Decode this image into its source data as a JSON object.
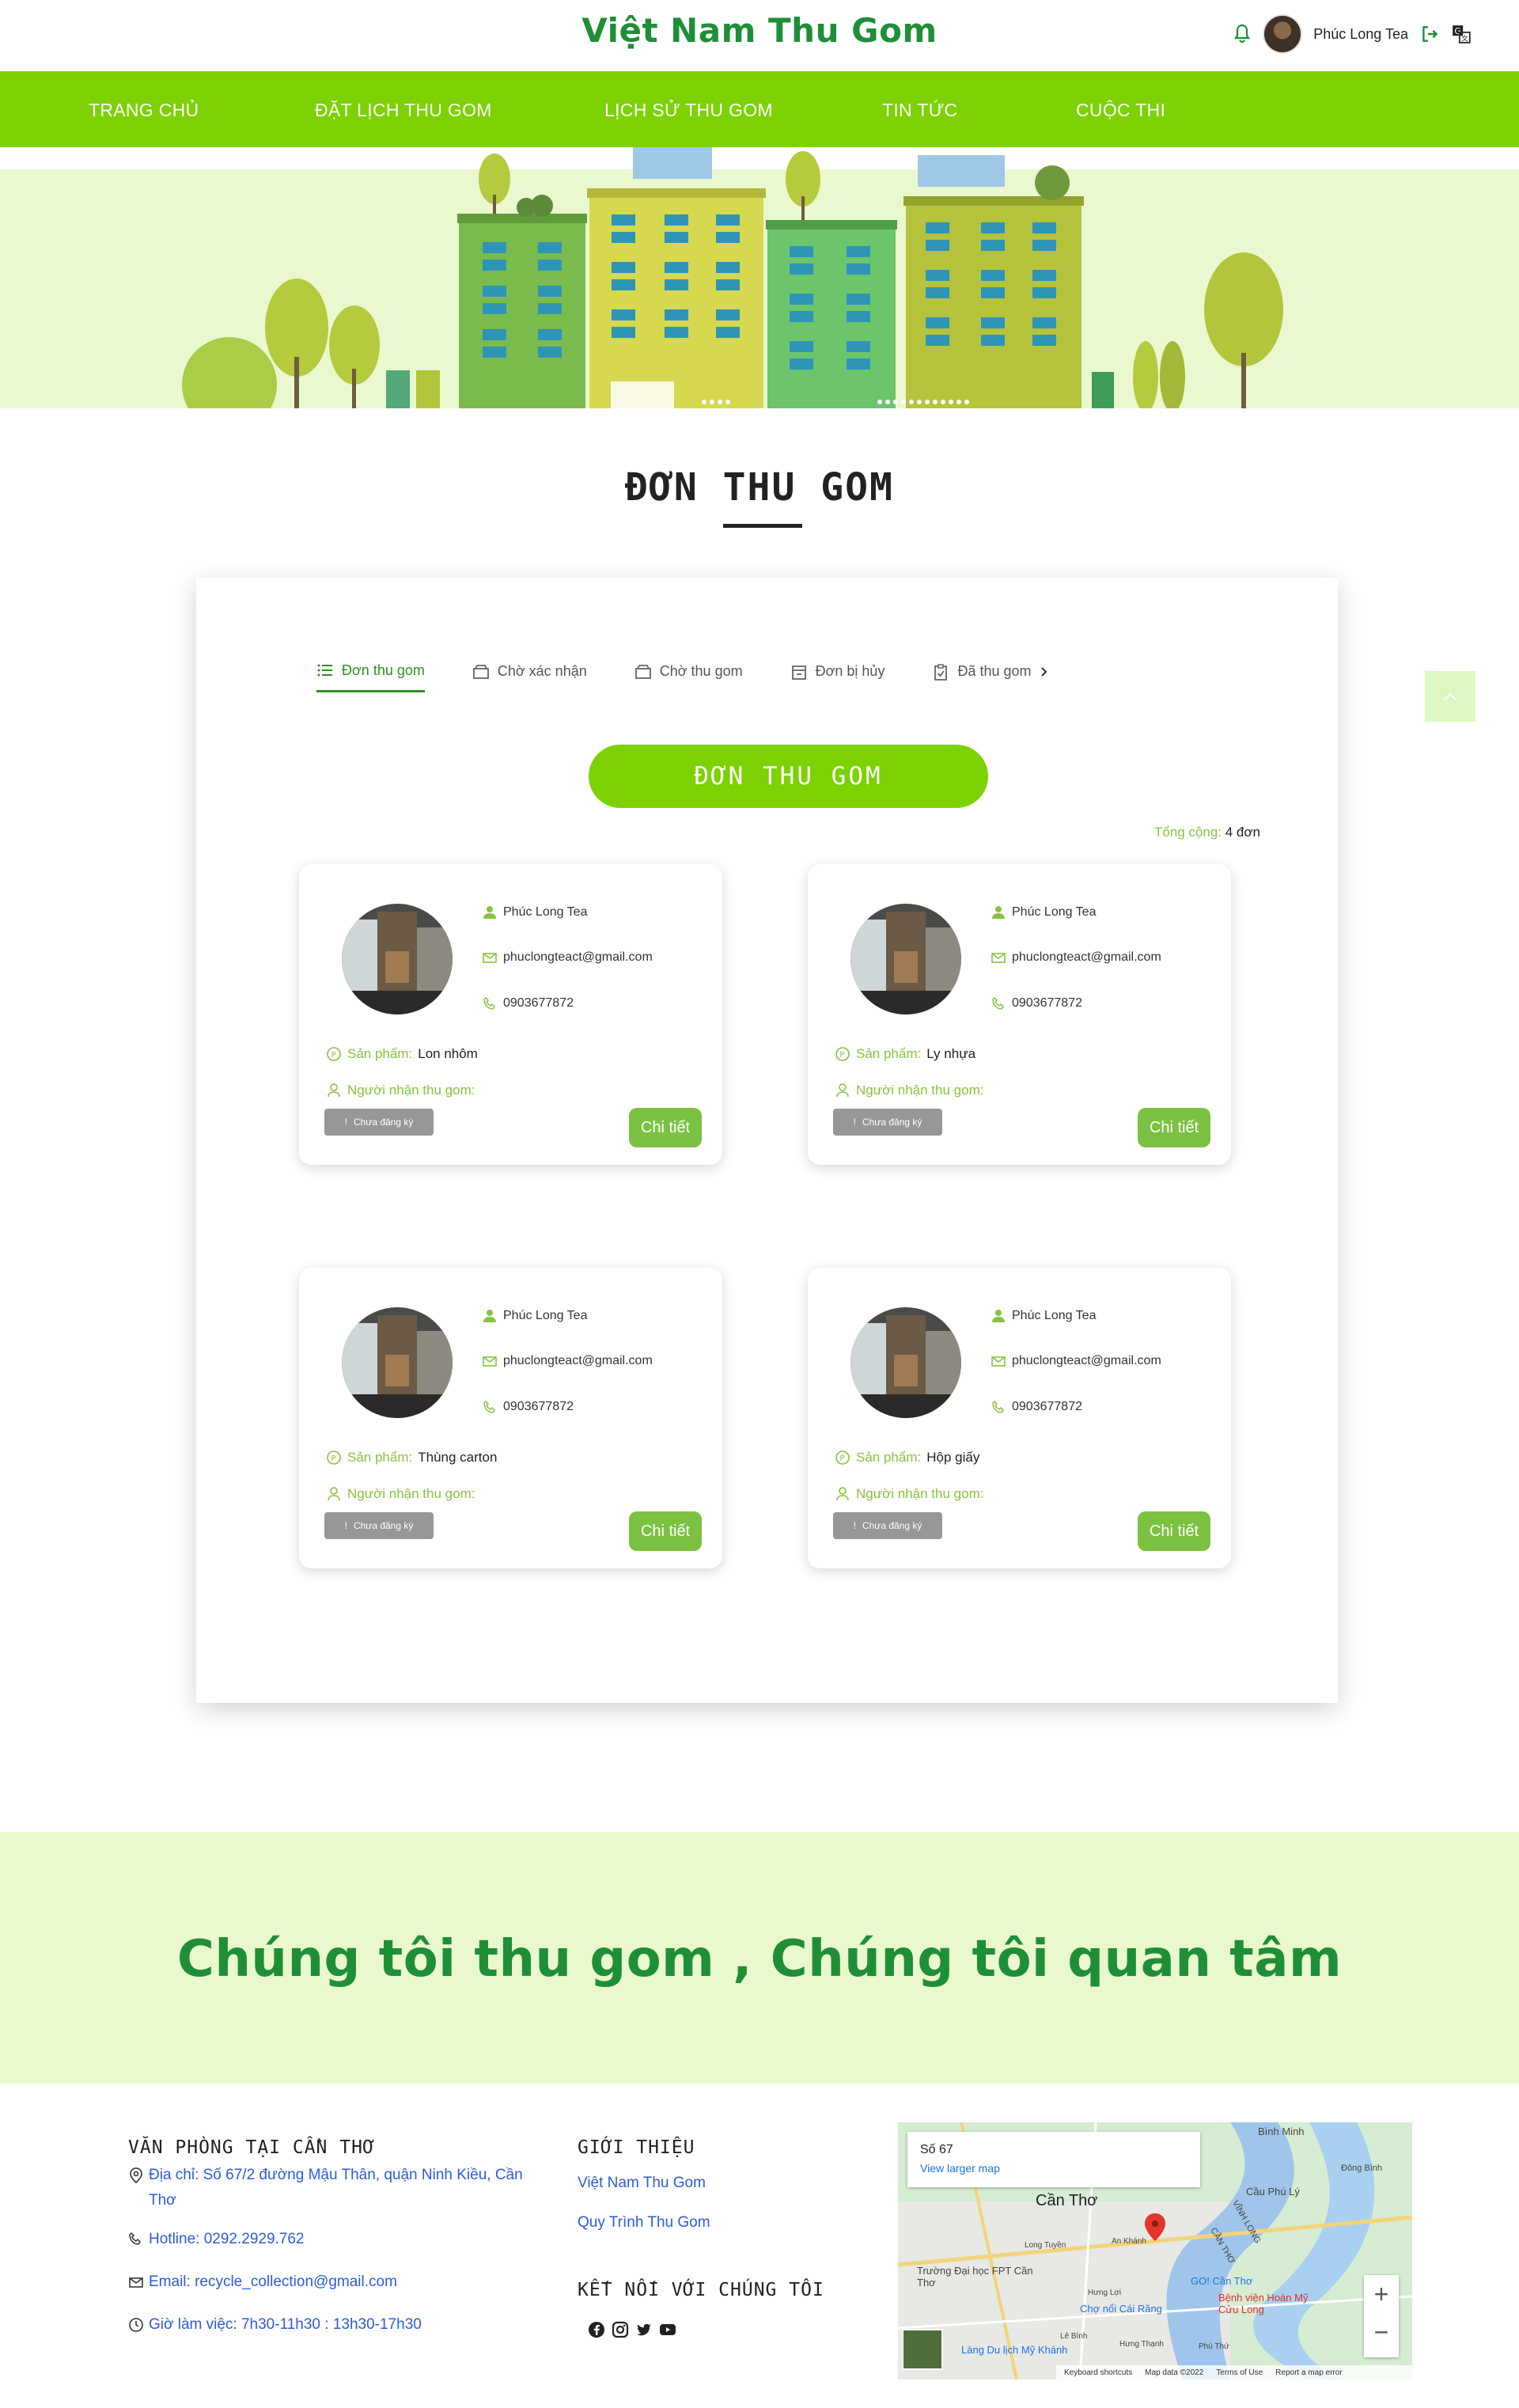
{
  "header": {
    "brand": "Việt Nam Thu Gom",
    "user_name": "Phúc Long Tea"
  },
  "nav": {
    "items": [
      "TRANG CHỦ",
      "ĐẶT LỊCH THU GOM",
      "LỊCH SỬ THU GOM",
      "TIN TỨC",
      "CUỘC THI"
    ]
  },
  "section": {
    "title": "ĐƠN THU GOM"
  },
  "tabs": [
    {
      "label": "Đơn thu gom",
      "icon": "list-icon",
      "active": true
    },
    {
      "label": "Chờ xác nhận",
      "icon": "box-icon",
      "active": false
    },
    {
      "label": "Chờ thu gom",
      "icon": "box-icon",
      "active": false
    },
    {
      "label": "Đơn bị hủy",
      "icon": "calendar-icon",
      "active": false
    },
    {
      "label": "Đã thu gom",
      "icon": "clipboard-check-icon",
      "active": false
    }
  ],
  "order_button": "ĐƠN THU GOM",
  "total": {
    "label": "Tổng cộng:",
    "value": "4 đơn"
  },
  "orders": [
    {
      "name": "Phúc Long Tea",
      "email": "phuclongteact@gmail.com",
      "phone": "0903677872",
      "product_label": "Sản phẩm:",
      "product": "Lon nhôm",
      "receiver_label": "Người nhận thu gom:",
      "status": "Chưa đăng ký",
      "button": "Chi tiết"
    },
    {
      "name": "Phúc Long Tea",
      "email": "phuclongteact@gmail.com",
      "phone": "0903677872",
      "product_label": "Sản phẩm:",
      "product": "Ly nhựa",
      "receiver_label": "Người nhận thu gom:",
      "status": "Chưa đăng ký",
      "button": "Chi tiết"
    },
    {
      "name": "Phúc Long Tea",
      "email": "phuclongteact@gmail.com",
      "phone": "0903677872",
      "product_label": "Sản phẩm:",
      "product": "Thùng carton",
      "receiver_label": "Người nhận thu gom:",
      "status": "Chưa đăng ký",
      "button": "Chi tiết"
    },
    {
      "name": "Phúc Long Tea",
      "email": "phuclongteact@gmail.com",
      "phone": "0903677872",
      "product_label": "Sản phẩm:",
      "product": "Hộp giấy",
      "receiver_label": "Người nhận thu gom:",
      "status": "Chưa đăng ký",
      "button": "Chi tiết"
    }
  ],
  "slogan": "Chúng tôi thu gom , Chúng tôi quan tâm",
  "footer": {
    "office_heading": "VĂN PHÒNG TẠI CẦN THƠ",
    "address": "Địa chỉ: Số 67/2 đường Mậu Thân, quận Ninh Kiều, Cần Thơ",
    "hotline": "Hotline: 0292.2929.762",
    "email": "Email: recycle_collection@gmail.com",
    "hours": "Giờ làm việc: 7h30-11h30 : 13h30-17h30",
    "about_heading": "GIỚI THIỆU",
    "about_links": [
      "Việt Nam Thu Gom",
      "Quy Trình Thu Gom"
    ],
    "connect_heading": "KẾT NỐI VỚI CHÚNG TÔI",
    "social_icons": [
      "facebook-icon",
      "instagram-icon",
      "twitter-icon",
      "youtube-icon"
    ]
  },
  "map": {
    "popup_title": "Số 67",
    "popup_link": "View larger map",
    "labels": [
      "Bình Minh",
      "Cần Thơ",
      "Cầu Phú Lý",
      "Đông Bình",
      "Trường Đại học FPT Cần Thơ",
      "Chợ nổi Cái Răng",
      "Bệnh viện Hoàn Mỹ Cửu Long",
      "Làng Du lịch Mỹ Khánh",
      "GO! Cần Thơ",
      "VĨNH LONG",
      "CẦN THƠ",
      "Long Tuyền",
      "An Khánh",
      "Hưng Lợi",
      "Lê Bình",
      "Hưng Thạnh",
      "Phú Thứ"
    ],
    "footer": [
      "Keyboard shortcuts",
      "Map data ©2022",
      "Terms of Use",
      "Report a map error"
    ]
  },
  "colors": {
    "brand_green": "#1e8f36",
    "nav_green": "#7cd202",
    "button_green": "#7cc242",
    "light_green_bg": "#eaf8cd",
    "link_blue": "#2d5bd9"
  }
}
